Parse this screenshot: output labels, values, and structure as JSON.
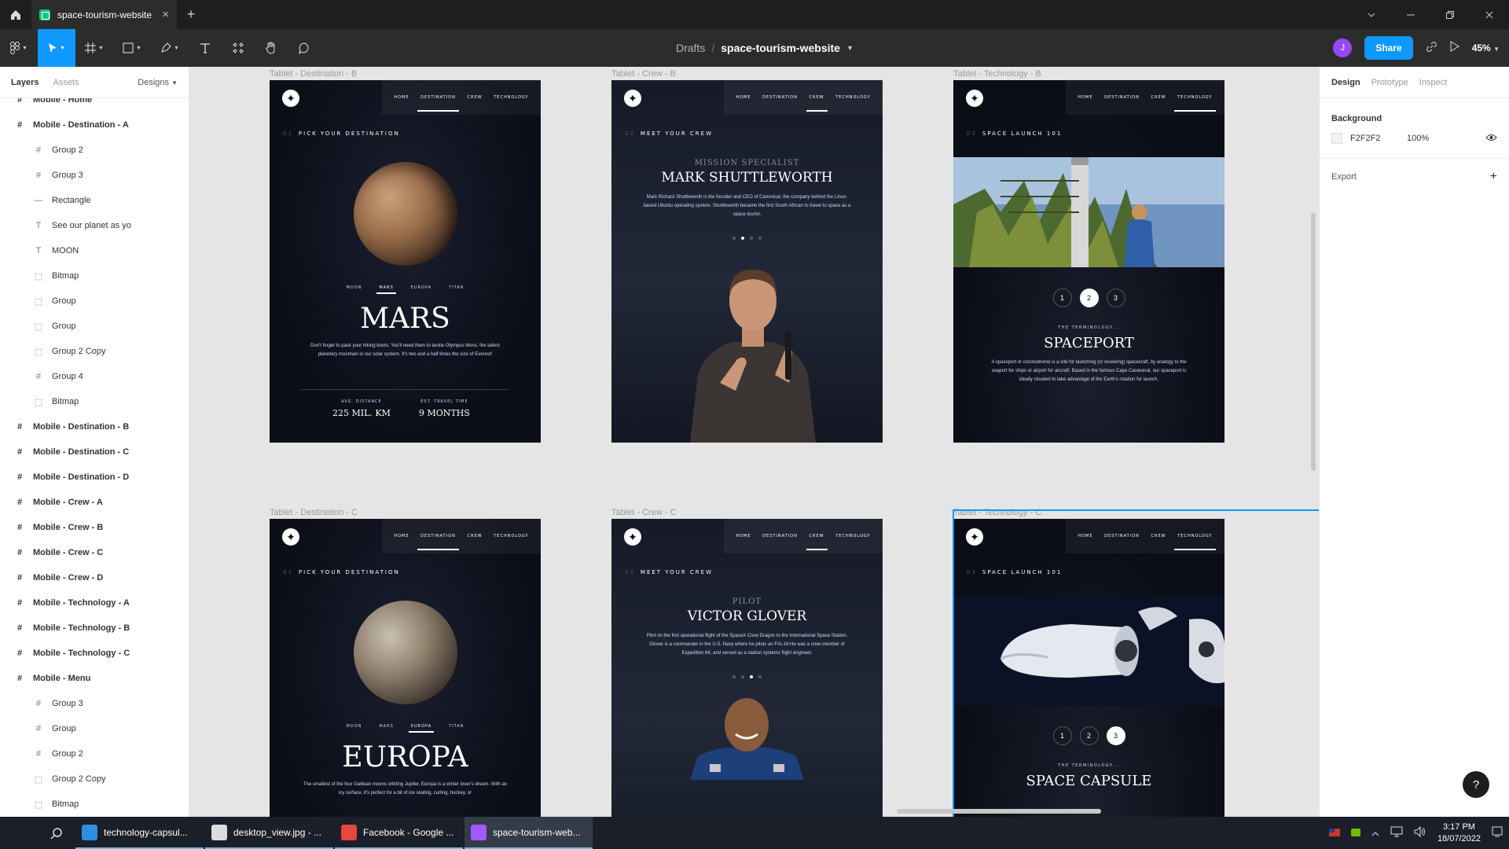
{
  "titlebar": {
    "tab_title": "space-tourism-website",
    "close": "×",
    "new_tab": "+"
  },
  "toolbar": {
    "location": "Drafts",
    "separator": "/",
    "file_name": "space-tourism-website",
    "avatar_initial": "J",
    "share_label": "Share",
    "zoom": "45%"
  },
  "left_panel": {
    "tabs": {
      "layers": "Layers",
      "assets": "Assets",
      "pages": "Designs"
    },
    "layers": [
      {
        "name": "Mobile - Home",
        "level": "top",
        "icon": "frame-icon"
      },
      {
        "name": "Mobile - Destination - A",
        "level": "top",
        "icon": "frame-icon"
      },
      {
        "name": "Group 2",
        "level": "child",
        "icon": "frame-icon"
      },
      {
        "name": "Group 3",
        "level": "child",
        "icon": "frame-icon"
      },
      {
        "name": "Rectangle",
        "level": "child",
        "icon": "line-icon"
      },
      {
        "name": "See our planet as yo",
        "level": "child",
        "icon": "text-icon"
      },
      {
        "name": "MOON",
        "level": "child",
        "icon": "text-icon"
      },
      {
        "name": "Bitmap",
        "level": "child",
        "icon": "dashed-icon"
      },
      {
        "name": "Group",
        "level": "child",
        "icon": "dashed-icon"
      },
      {
        "name": "Group",
        "level": "child",
        "icon": "dashed-icon"
      },
      {
        "name": "Group 2 Copy",
        "level": "child",
        "icon": "dashed-icon"
      },
      {
        "name": "Group 4",
        "level": "child",
        "icon": "frame-icon"
      },
      {
        "name": "Bitmap",
        "level": "child",
        "icon": "dashed-icon"
      },
      {
        "name": "Mobile - Destination - B",
        "level": "top",
        "icon": "frame-icon"
      },
      {
        "name": "Mobile - Destination - C",
        "level": "top",
        "icon": "frame-icon"
      },
      {
        "name": "Mobile - Destination - D",
        "level": "top",
        "icon": "frame-icon"
      },
      {
        "name": "Mobile - Crew - A",
        "level": "top",
        "icon": "frame-icon"
      },
      {
        "name": "Mobile - Crew - B",
        "level": "top",
        "icon": "frame-icon"
      },
      {
        "name": "Mobile - Crew - C",
        "level": "top",
        "icon": "frame-icon"
      },
      {
        "name": "Mobile - Crew - D",
        "level": "top",
        "icon": "frame-icon"
      },
      {
        "name": "Mobile - Technology - A",
        "level": "top",
        "icon": "frame-icon"
      },
      {
        "name": "Mobile - Technology - B",
        "level": "top",
        "icon": "frame-icon"
      },
      {
        "name": "Mobile - Technology - C",
        "level": "top",
        "icon": "frame-icon"
      },
      {
        "name": "Mobile - Menu",
        "level": "top",
        "icon": "frame-icon"
      },
      {
        "name": "Group 3",
        "level": "child",
        "icon": "frame-icon"
      },
      {
        "name": "Group",
        "level": "child",
        "icon": "frame-icon"
      },
      {
        "name": "Group 2",
        "level": "child",
        "icon": "frame-icon"
      },
      {
        "name": "Group 2 Copy",
        "level": "child",
        "icon": "dashed-icon"
      },
      {
        "name": "Bitmap",
        "level": "child",
        "icon": "dashed-icon"
      }
    ]
  },
  "frames": {
    "nav": {
      "home": "HOME",
      "destination": "DESTINATION",
      "crew": "CREW",
      "technology": "TECHNOLOGY"
    },
    "dest_b": {
      "label": "Tablet - Destination - B",
      "kicker_num": "01",
      "kicker": "PICK YOUR DESTINATION",
      "tabs": [
        "MOON",
        "MARS",
        "EUROPA",
        "TITAN"
      ],
      "title": "MARS",
      "text": "Don't forget to pack your hiking boots. You'll need them to tackle Olympus Mons, the tallest planetary mountain in our solar system. It's two and a half times the size of Everest!",
      "dist_label": "AVG. DISTANCE",
      "dist": "225 MIL. KM",
      "time_label": "EST. TRAVEL TIME",
      "time": "9 MONTHS"
    },
    "crew_b": {
      "label": "Tablet - Crew - B",
      "kicker_num": "02",
      "kicker": "MEET YOUR CREW",
      "role": "MISSION SPECIALIST",
      "name": "MARK SHUTTLEWORTH",
      "text": "Mark Richard Shuttleworth is the founder and CEO of Canonical, the company behind the Linux-based Ubuntu operating system. Shuttleworth became the first South African to travel to space as a space tourist."
    },
    "tech_b": {
      "label": "Tablet - Technology - B",
      "kicker_num": "03",
      "kicker": "SPACE LAUNCH 101",
      "pages": [
        "1",
        "2",
        "3"
      ],
      "terminology": "THE TERMINOLOGY...",
      "title": "SPACEPORT",
      "text": "A spaceport or cosmodrome is a site for launching (or receiving) spacecraft, by analogy to the seaport for ships or airport for aircraft. Based in the famous Cape Canaveral, our spaceport is ideally situated to take advantage of the Earth's rotation for launch."
    },
    "dest_c": {
      "label": "Tablet - Destination - C",
      "kicker_num": "01",
      "kicker": "PICK YOUR DESTINATION",
      "tabs": [
        "MOON",
        "MARS",
        "EUROPA",
        "TITAN"
      ],
      "title": "EUROPA",
      "text": "The smallest of the four Galilean moons orbiting Jupiter, Europa is a winter lover's dream. With an icy surface, it's perfect for a bit of ice skating, curling, hockey, or"
    },
    "crew_c": {
      "label": "Tablet - Crew - C",
      "kicker_num": "02",
      "kicker": "MEET YOUR CREW",
      "role": "PILOT",
      "name": "VICTOR GLOVER",
      "text": "Pilot on the first operational flight of the SpaceX Crew Dragon to the International Space Station. Glover is a commander in the U.S. Navy where he pilots an F/A-18.He was a crew member of Expedition 64, and served as a station systems flight engineer."
    },
    "tech_c": {
      "label": "Tablet - Technology - C",
      "kicker_num": "03",
      "kicker": "SPACE LAUNCH 101",
      "pages": [
        "1",
        "2",
        "3"
      ],
      "terminology": "THE TERMINOLOGY...",
      "title": "SPACE CAPSULE"
    }
  },
  "right_panel": {
    "tabs": {
      "design": "Design",
      "prototype": "Prototype",
      "inspect": "Inspect"
    },
    "background_label": "Background",
    "bg_hex": "F2F2F2",
    "bg_opacity": "100%",
    "export_label": "Export",
    "export_add": "+"
  },
  "help": "?",
  "taskbar": {
    "apps": [
      {
        "label": "technology-capsul...",
        "color": "#2f8fe0"
      },
      {
        "label": "desktop_view.jpg - ...",
        "color": "#dcdcdc"
      },
      {
        "label": "Facebook - Google ...",
        "color": "#e8453c"
      },
      {
        "label": "space-tourism-web...",
        "color": "#a259ff"
      }
    ],
    "time": "3:17 PM",
    "date": "18/07/2022"
  }
}
